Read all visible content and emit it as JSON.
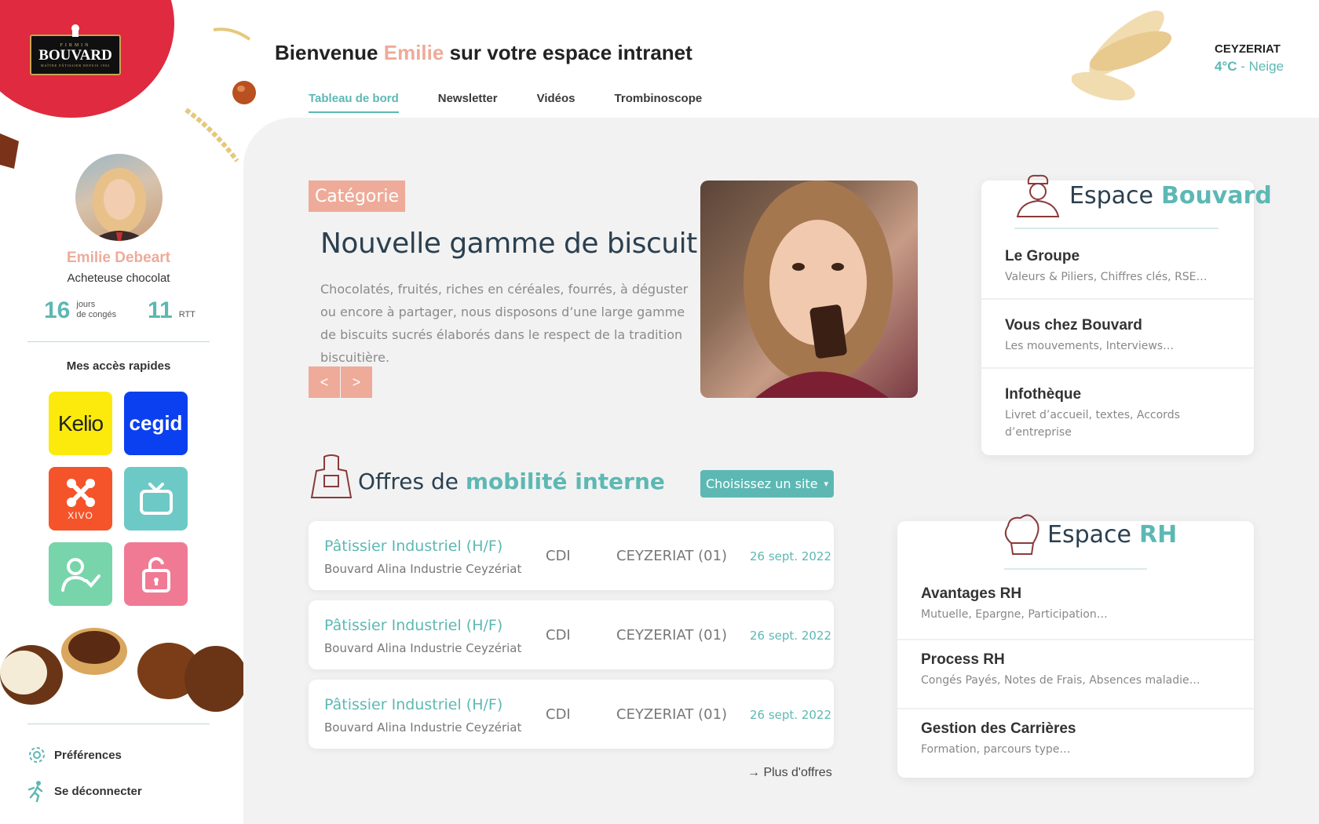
{
  "brand": {
    "logo_top": "FIRMIN",
    "logo_main": "BOUVARD",
    "logo_bottom": "MAÎTRE PÂTISSIER DEPUIS 1902"
  },
  "header": {
    "title_before": "Bienvenue",
    "title_name": "Emilie",
    "title_after": "sur votre espace intranet",
    "tabs": [
      {
        "label": "Tableau de bord",
        "active": true
      },
      {
        "label": "Newsletter",
        "active": false
      },
      {
        "label": "Vidéos",
        "active": false
      },
      {
        "label": "Trombinoscope",
        "active": false
      }
    ]
  },
  "weather": {
    "city": "CEYZERIAT",
    "temp": "4°C",
    "separator": " - ",
    "condition": "Neige"
  },
  "user": {
    "name": "Emilie Debeart",
    "role": "Acheteuse chocolat",
    "stats": [
      {
        "value": "16",
        "label_line1": "jours",
        "label_line2": "de congés"
      },
      {
        "value": "11",
        "label_line1": "",
        "label_line2": "RTT"
      }
    ]
  },
  "quick_access": {
    "title": "Mes accès rapides",
    "tiles": [
      {
        "name": "kelio",
        "label": "Kelio",
        "color": "#fcea0c",
        "icon": "kelio-logo"
      },
      {
        "name": "cegid",
        "label": "cegid",
        "color": "#0b40f0",
        "icon": "cegid-logo"
      },
      {
        "name": "xivo",
        "label": "XIVO",
        "color": "#f5542a",
        "icon": "xivo-logo"
      },
      {
        "name": "tv",
        "label": "",
        "color": "#6dc9c6",
        "icon": "tv-icon"
      },
      {
        "name": "user-check",
        "label": "",
        "color": "#78d4aa",
        "icon": "user-check-icon"
      },
      {
        "name": "lock",
        "label": "",
        "color": "#f07a94",
        "icon": "lock-icon"
      }
    ]
  },
  "sidebar_bottom": {
    "preferences": "Préférences",
    "logout": "Se déconnecter"
  },
  "article": {
    "category": "Catégorie",
    "title": "Nouvelle gamme de biscuit",
    "text": "Chocolatés, fruités, riches en céréales, fourrés, à déguster ou encore à partager, nous disposons d’une large gamme de biscuits sucrés élaborés dans le respect de la tradition biscuitière.",
    "prev": "<",
    "next": ">"
  },
  "offers": {
    "title_plain": "Offres de",
    "title_bold": "mobilité interne",
    "select_label": "Choisissez un site",
    "items": [
      {
        "title": "Pâtissier Industriel (H/F)",
        "company": "Bouvard Alina Industrie Ceyzériat",
        "type": "CDI",
        "location": "CEYZERIAT (01)",
        "date": "26 sept. 2022"
      },
      {
        "title": "Pâtissier Industriel (H/F)",
        "company": "Bouvard Alina Industrie Ceyzériat",
        "type": "CDI",
        "location": "CEYZERIAT (01)",
        "date": "26 sept. 2022"
      },
      {
        "title": "Pâtissier Industriel (H/F)",
        "company": "Bouvard Alina Industrie Ceyzériat",
        "type": "CDI",
        "location": "CEYZERIAT (01)",
        "date": "26 sept. 2022"
      }
    ],
    "more": "→ Plus d'offres"
  },
  "espace_bouvard": {
    "title_plain": "Espace",
    "title_bold": "Bouvard",
    "items": [
      {
        "title": "Le Groupe",
        "sub": "Valeurs & Piliers, Chiffres clés, RSE…"
      },
      {
        "title": "Vous chez Bouvard",
        "sub": "Les mouvements, Interviews…"
      },
      {
        "title": "Infothèque",
        "sub": "Livret d’accueil, textes, Accords d’entreprise"
      }
    ]
  },
  "espace_rh": {
    "title_plain": "Espace",
    "title_bold": "RH",
    "items": [
      {
        "title": "Avantages RH",
        "sub": "Mutuelle, Epargne, Participation…"
      },
      {
        "title": "Process RH",
        "sub": "Congés Payés, Notes de Frais, Absences maladie…"
      },
      {
        "title": "Gestion des Carrières",
        "sub": "Formation, parcours type…"
      }
    ]
  },
  "colors": {
    "accent": "#5db8b4",
    "salmon": "#eeab99",
    "brand_red": "#e02a3f",
    "bg": "#f2f2f2"
  }
}
